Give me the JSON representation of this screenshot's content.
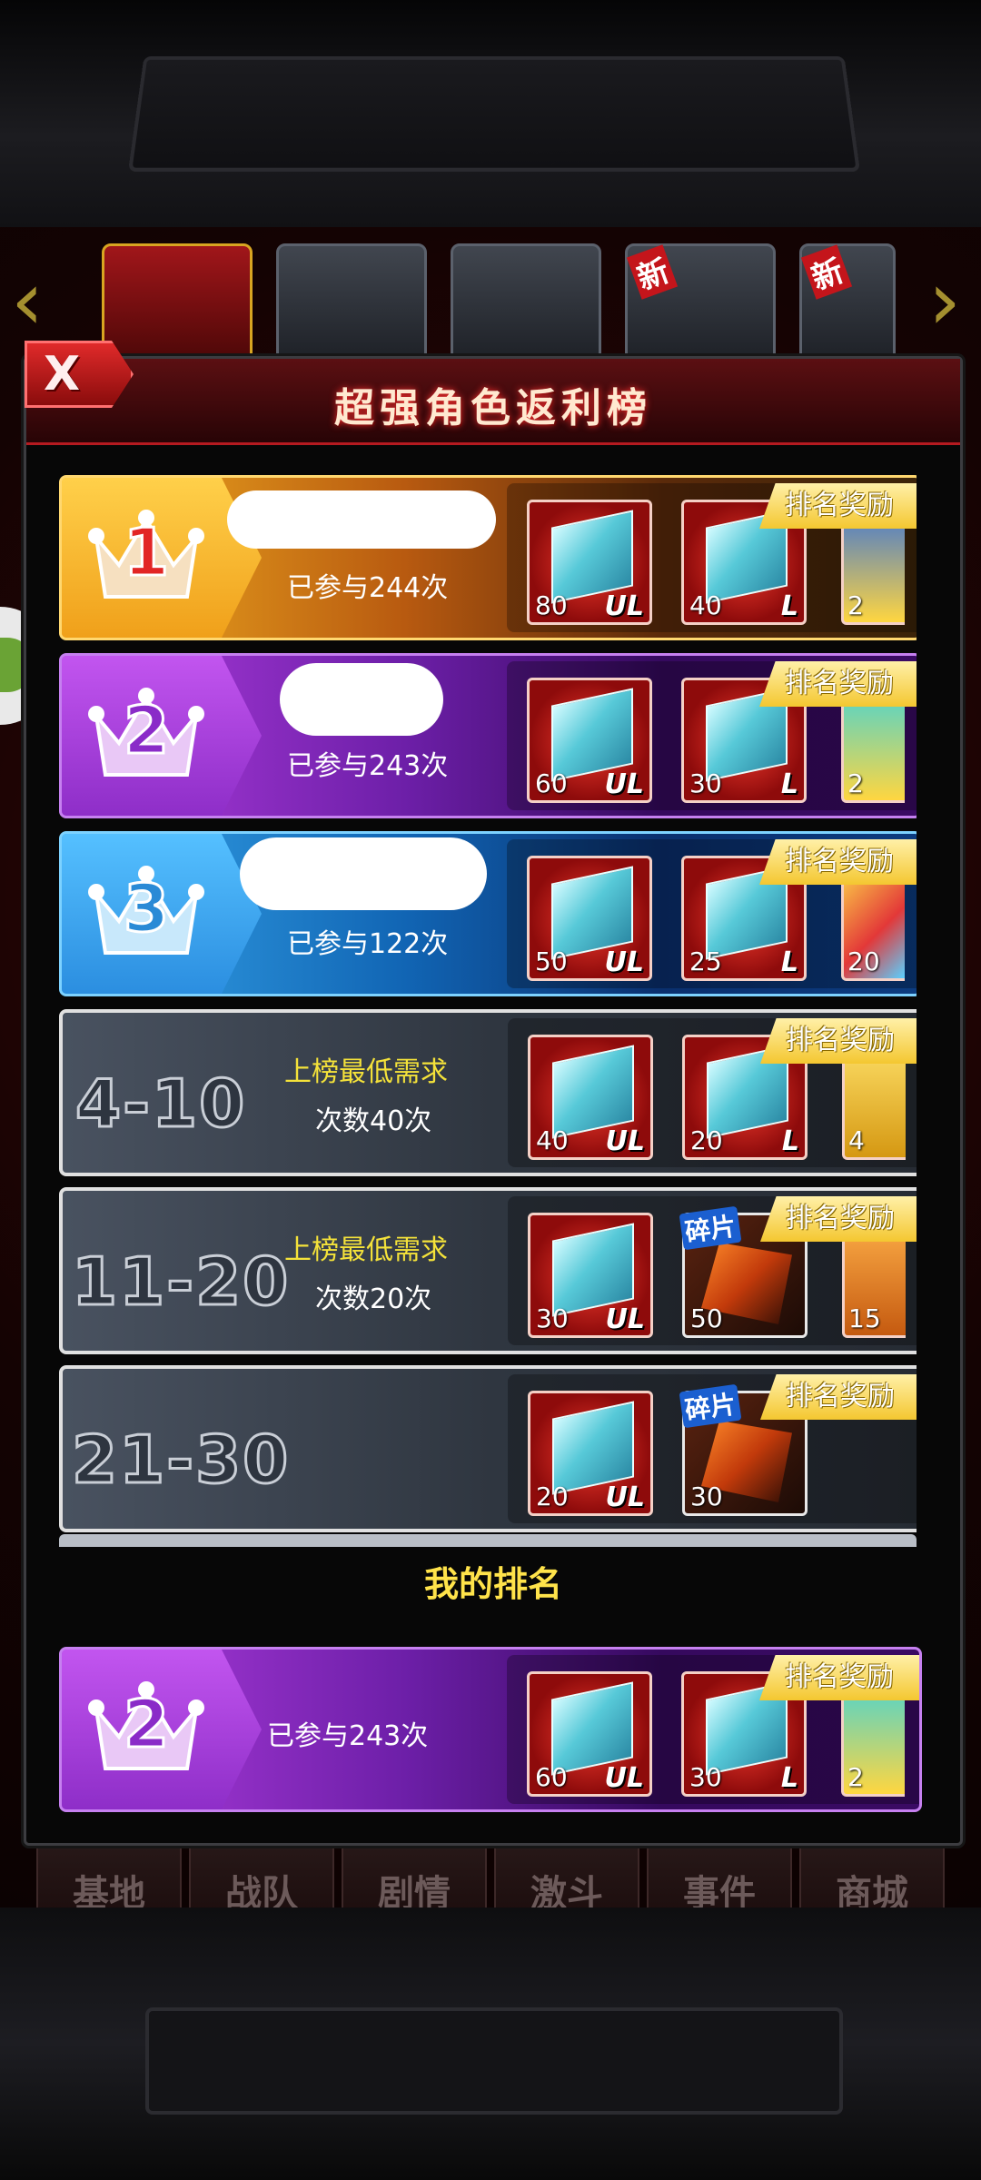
{
  "carousel": {
    "new_badge": "新",
    "items": [
      {
        "label": "",
        "active": true
      },
      {
        "label": "",
        "active": false
      },
      {
        "label": "",
        "active": false
      },
      {
        "label": "",
        "new": true
      },
      {
        "label": "",
        "new": true
      }
    ]
  },
  "modal": {
    "close_label": "X",
    "title": "超强角色返利榜",
    "reward_tag": "排名奖励"
  },
  "rows": [
    {
      "rank": "1",
      "count_text": "已参与244次",
      "rewards": [
        {
          "qty": "80",
          "tier": "UL"
        },
        {
          "qty": "40",
          "tier": "L"
        }
      ],
      "extra_qty": "2"
    },
    {
      "rank": "2",
      "count_text": "已参与243次",
      "rewards": [
        {
          "qty": "60",
          "tier": "UL"
        },
        {
          "qty": "30",
          "tier": "L"
        }
      ],
      "extra_qty": "2"
    },
    {
      "rank": "3",
      "count_text": "已参与122次",
      "rewards": [
        {
          "qty": "50",
          "tier": "UL"
        },
        {
          "qty": "25",
          "tier": "L"
        }
      ],
      "extra_qty": "20"
    },
    {
      "range": "4-10",
      "req_title": "上榜最低需求",
      "req_value": "次数40次",
      "rewards": [
        {
          "qty": "40",
          "tier": "UL"
        },
        {
          "qty": "20",
          "tier": "L"
        }
      ],
      "extra_qty": "4"
    },
    {
      "range": "11-20",
      "req_title": "上榜最低需求",
      "req_value": "次数20次",
      "rewards": [
        {
          "qty": "30",
          "tier": "UL"
        }
      ],
      "fragment": {
        "label": "碎片",
        "qty": "50"
      },
      "extra_qty": "15"
    },
    {
      "range": "21-30",
      "rewards": [
        {
          "qty": "20",
          "tier": "UL"
        }
      ],
      "fragment": {
        "label": "碎片",
        "qty": "30"
      }
    }
  ],
  "mine": {
    "title": "我的排名",
    "rank": "2",
    "count_text": "已参与243次",
    "rewards": [
      {
        "qty": "60",
        "tier": "UL"
      },
      {
        "qty": "30",
        "tier": "L"
      }
    ],
    "extra_qty": "2"
  },
  "nav": [
    "基地",
    "战队",
    "剧情",
    "激斗",
    "事件",
    "商城"
  ],
  "colors": {
    "gold": "#f3b321",
    "purple": "#8e2ec8",
    "blue": "#2b8ee0",
    "accent_red": "#b51a20",
    "title_yellow": "#ffe34a"
  }
}
